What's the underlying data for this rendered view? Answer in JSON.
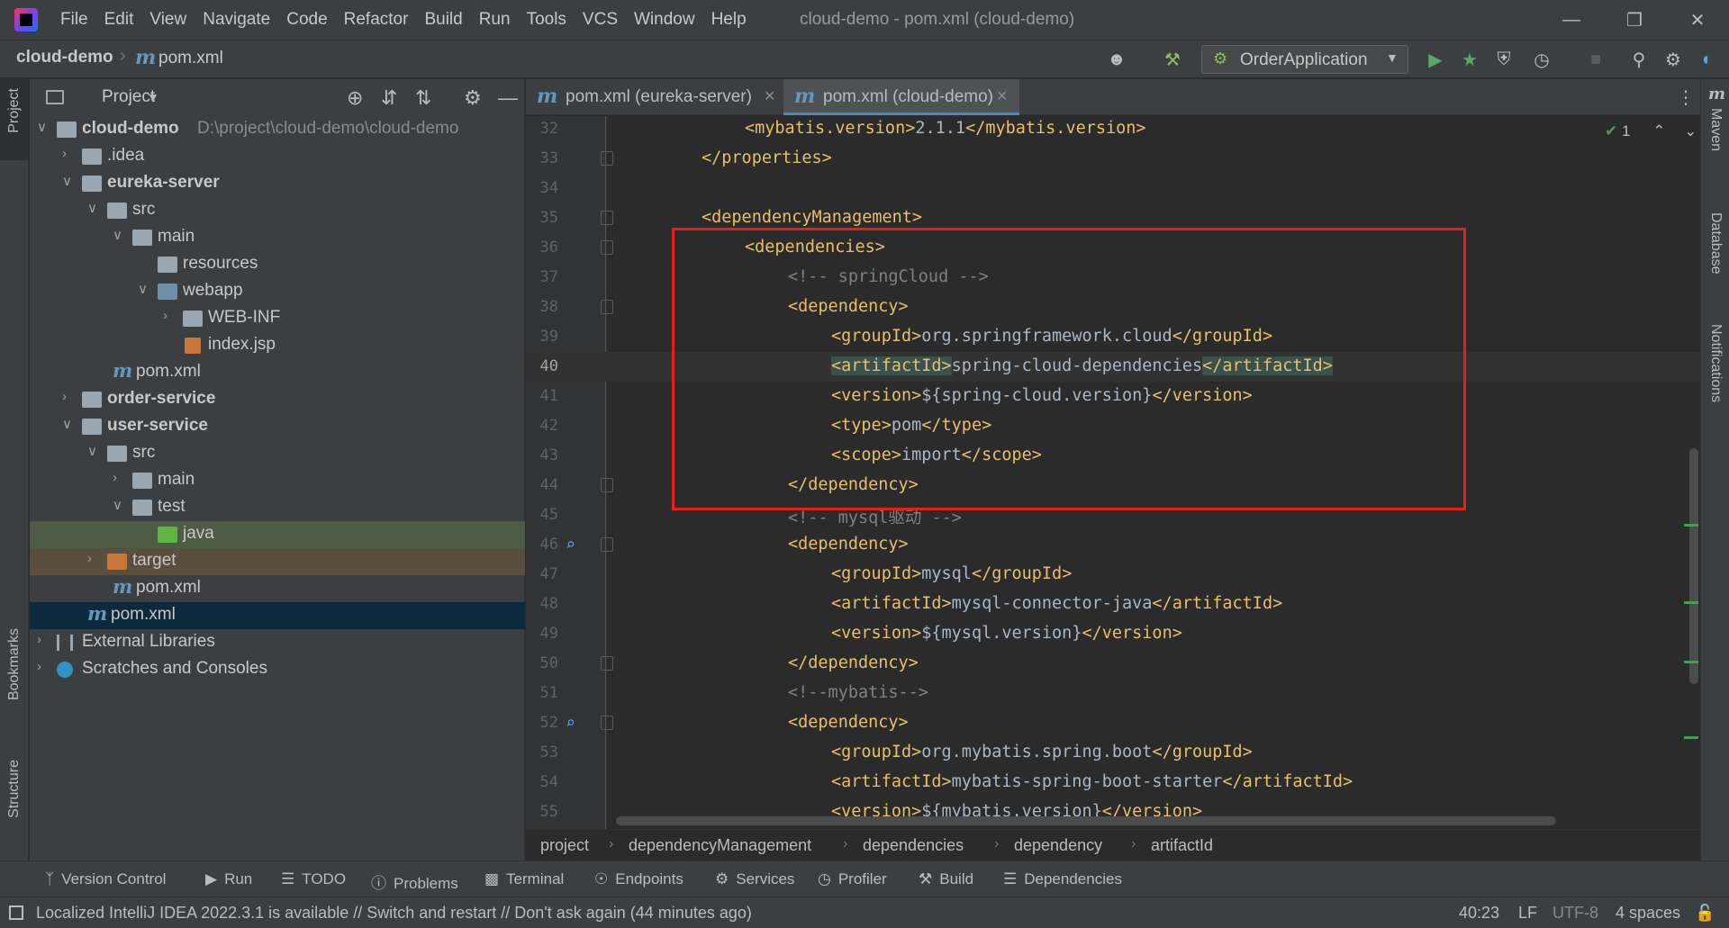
{
  "window": {
    "title": "cloud-demo - pom.xml (cloud-demo)",
    "menu": [
      "File",
      "Edit",
      "View",
      "Navigate",
      "Code",
      "Refactor",
      "Build",
      "Run",
      "Tools",
      "VCS",
      "Window",
      "Help"
    ]
  },
  "nav": {
    "project": "cloud-demo",
    "file": "pom.xml",
    "run_config": "OrderApplication"
  },
  "left_stripe": {
    "project": "Project",
    "bookmarks": "Bookmarks",
    "structure": "Structure"
  },
  "right_stripe": {
    "maven": "Maven",
    "database": "Database",
    "notifications": "Notifications"
  },
  "project_panel": {
    "title": "Project",
    "tree": [
      {
        "label": "cloud-demo",
        "path": "D:\\project\\cloud-demo\\cloud-demo"
      },
      {
        "label": ".idea"
      },
      {
        "label": "eureka-server"
      },
      {
        "label": "src"
      },
      {
        "label": "main"
      },
      {
        "label": "resources"
      },
      {
        "label": "webapp"
      },
      {
        "label": "WEB-INF"
      },
      {
        "label": "index.jsp"
      },
      {
        "label": "pom.xml"
      },
      {
        "label": "order-service"
      },
      {
        "label": "user-service"
      },
      {
        "label": "src"
      },
      {
        "label": "main"
      },
      {
        "label": "test"
      },
      {
        "label": "java"
      },
      {
        "label": "target"
      },
      {
        "label": "pom.xml"
      },
      {
        "label": "pom.xml"
      },
      {
        "label": "External Libraries"
      },
      {
        "label": "Scratches and Consoles"
      }
    ]
  },
  "tabs": [
    {
      "label": "pom.xml (eureka-server)"
    },
    {
      "label": "pom.xml (cloud-demo)"
    }
  ],
  "editor": {
    "inspection_count": "1",
    "lines": [
      {
        "n": "32",
        "a": "<mybatis.version>",
        "b": "2.1.1",
        "c": "</mybatis.version>"
      },
      {
        "n": "33",
        "a": "</properties>",
        "b": "",
        "c": ""
      },
      {
        "n": "34",
        "a": "",
        "b": "",
        "c": ""
      },
      {
        "n": "35",
        "a": "<dependencyManagement>",
        "b": "",
        "c": ""
      },
      {
        "n": "36",
        "a": "<dependencies>",
        "b": "",
        "c": ""
      },
      {
        "n": "37",
        "a": "",
        "b": "<!-- springCloud -->",
        "c": ""
      },
      {
        "n": "38",
        "a": "<dependency>",
        "b": "",
        "c": ""
      },
      {
        "n": "39",
        "a": "<groupId>",
        "b": "org.springframework.cloud",
        "c": "</groupId>"
      },
      {
        "n": "40",
        "a": "<artifactId>",
        "b": "spring-cloud-dependencies",
        "c": "</artifactId>"
      },
      {
        "n": "41",
        "a": "<version>",
        "b": "${spring-cloud.version}",
        "c": "</version>"
      },
      {
        "n": "42",
        "a": "<type>",
        "b": "pom",
        "c": "</type>"
      },
      {
        "n": "43",
        "a": "<scope>",
        "b": "import",
        "c": "</scope>"
      },
      {
        "n": "44",
        "a": "</dependency>",
        "b": "",
        "c": ""
      },
      {
        "n": "45",
        "a": "",
        "b": "<!-- mysql驱动 -->",
        "c": ""
      },
      {
        "n": "46",
        "a": "<dependency>",
        "b": "",
        "c": ""
      },
      {
        "n": "47",
        "a": "<groupId>",
        "b": "mysql",
        "c": "</groupId>"
      },
      {
        "n": "48",
        "a": "<artifactId>",
        "b": "mysql-connector-java",
        "c": "</artifactId>"
      },
      {
        "n": "49",
        "a": "<version>",
        "b": "${mysql.version}",
        "c": "</version>"
      },
      {
        "n": "50",
        "a": "</dependency>",
        "b": "",
        "c": ""
      },
      {
        "n": "51",
        "a": "",
        "b": "<!--mybatis-->",
        "c": ""
      },
      {
        "n": "52",
        "a": "<dependency>",
        "b": "",
        "c": ""
      },
      {
        "n": "53",
        "a": "<groupId>",
        "b": "org.mybatis.spring.boot",
        "c": "</groupId>"
      },
      {
        "n": "54",
        "a": "<artifactId>",
        "b": "mybatis-spring-boot-starter",
        "c": "</artifactId>"
      },
      {
        "n": "55",
        "a": "<version>",
        "b": "${mybatis.version}",
        "c": "</version>"
      }
    ]
  },
  "editor_breadcrumbs": [
    "project",
    "dependencyManagement",
    "dependencies",
    "dependency",
    "artifactId"
  ],
  "tool_windows": [
    "Version Control",
    "Run",
    "TODO",
    "Problems",
    "Terminal",
    "Endpoints",
    "Services",
    "Profiler",
    "Build",
    "Dependencies"
  ],
  "status": {
    "message": "Localized IntelliJ IDEA 2022.3.1 is available // Switch and restart // Don't ask again (44 minutes ago)",
    "position": "40:23",
    "line_sep": "LF",
    "encoding": "UTF-8",
    "indent": "4 spaces"
  },
  "colors": {
    "tag": "#e8bf6a",
    "text": "#a9b7c6",
    "comment": "#808080",
    "highlight_box": "#e4201c",
    "selection": "#0d293e"
  }
}
